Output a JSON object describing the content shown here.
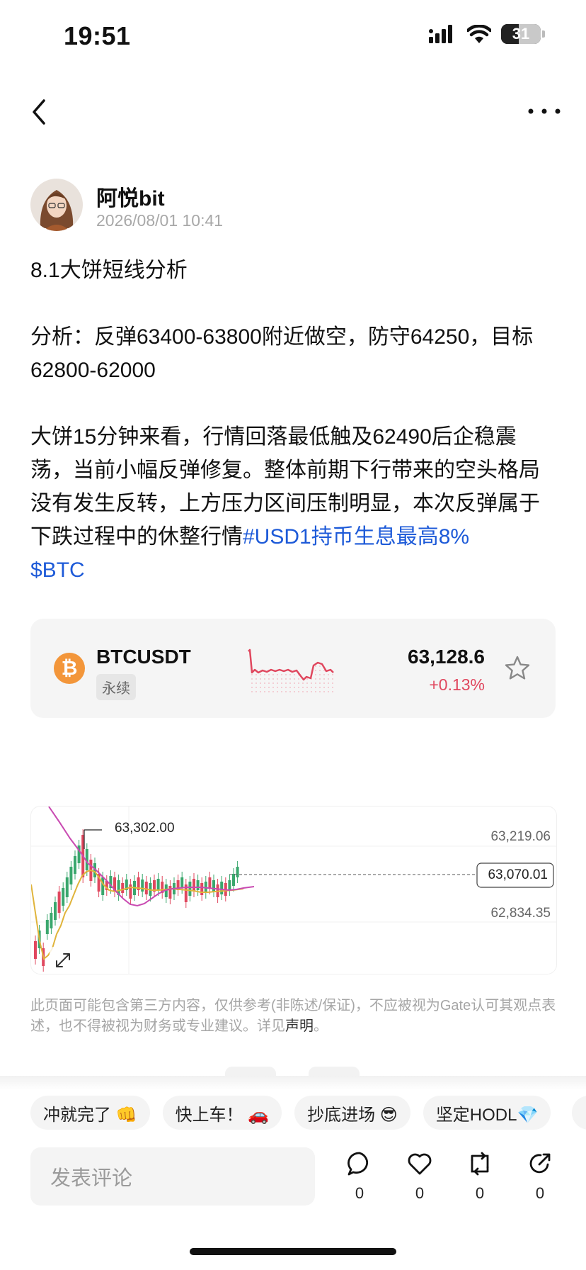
{
  "status_bar": {
    "time": "19:51",
    "battery": "31"
  },
  "author": {
    "name": "阿悦bit",
    "time": "2026/08/01 10:41"
  },
  "post": {
    "title": "8.1大饼短线分析",
    "analysis": "分析：反弹63400-63800附近做空，防守64250，目标62800-62000",
    "body": "大饼15分钟来看，行情回落最低触及62490后企稳震荡，当前小幅反弹修复。整体前期下行带来的空头格局没有发生反转，上方压力区间压制明显，本次反弹属于下跌过程中的休整行情",
    "hashtag": "#USD1持币生息最高8%",
    "cashtag": "$BTC"
  },
  "ticker": {
    "icon": "bitcoin-icon",
    "symbol": "BTCUSDT",
    "type": "永续",
    "price": "63,128.6",
    "change": "+0.13%",
    "change_color": "#e0475e"
  },
  "kline": {
    "high_marker": "63,302.00",
    "levels": [
      "63,219.06",
      "63,070.01",
      "62,834.35"
    ]
  },
  "disclaimer": {
    "text": "此页面可能包含第三方内容，仅供参考(非陈述/保证)，不应被视为Gate认可其观点表述，也不得被视为财务或专业建议。详见",
    "link": "声明",
    "end": "。"
  },
  "chips": [
    {
      "label": "冲就完了 👊"
    },
    {
      "label": "快上车！ 🚗"
    },
    {
      "label": "抄底进场 😎"
    },
    {
      "label": "坚定HODL💎"
    }
  ],
  "comment_placeholder": "发表评论",
  "actions": [
    {
      "icon": "comment-icon",
      "count": "0"
    },
    {
      "icon": "like-icon",
      "count": "0"
    },
    {
      "icon": "repost-icon",
      "count": "0"
    },
    {
      "icon": "share-icon",
      "count": "0"
    }
  ]
}
